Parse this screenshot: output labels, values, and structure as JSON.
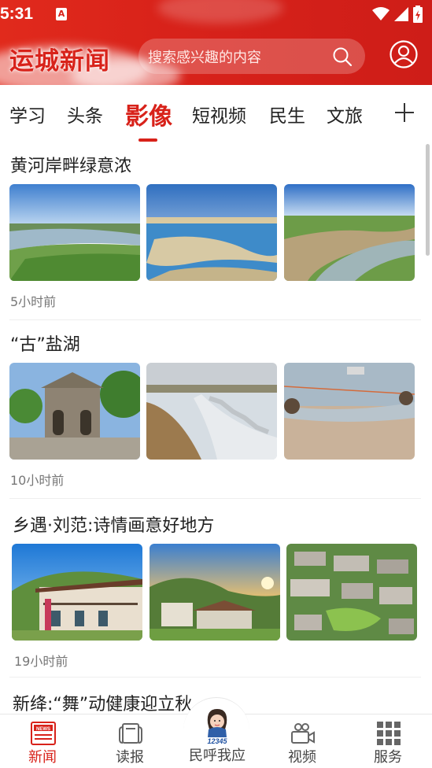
{
  "status": {
    "time": "5:31",
    "notification_badge": "A"
  },
  "header": {
    "logo": "运城新闻",
    "search_placeholder": "搜索感兴趣的内容",
    "brand_color": "#d8221a"
  },
  "tabs": [
    {
      "label": "学习",
      "active": false
    },
    {
      "label": "头条",
      "active": false
    },
    {
      "label": "影像",
      "active": true
    },
    {
      "label": "短视频",
      "active": false
    },
    {
      "label": "民生",
      "active": false
    },
    {
      "label": "文旅",
      "active": false
    }
  ],
  "articles": [
    {
      "title": "黄河岸畔绿意浓",
      "time": "5小时前",
      "images": [
        "river-aerial-green-banks",
        "river-blue-sky-reflection",
        "river-bend-farmland"
      ]
    },
    {
      "title": "“古”盐湖",
      "time": "10小时前",
      "images": [
        "ancient-stone-pavilion",
        "salt-lake-shore-stones",
        "fishermen-net-lake"
      ]
    },
    {
      "title": "乡遇·刘范:诗情画意好地方",
      "time": "19小时前",
      "images": [
        "village-house-mountain",
        "village-sunset-hills",
        "village-aerial-rooftops"
      ]
    },
    {
      "title": "新绛:“舞”动健康迎立秋",
      "time": "",
      "images": []
    }
  ],
  "bottom_nav": [
    {
      "label": "新闻",
      "icon": "news-icon",
      "active": true
    },
    {
      "label": "读报",
      "icon": "newspaper-icon",
      "active": false
    },
    {
      "label": "民呼我应",
      "icon": "hotline-12345-icon",
      "badge": "12345",
      "active": false
    },
    {
      "label": "视频",
      "icon": "video-camera-icon",
      "active": false
    },
    {
      "label": "服务",
      "icon": "grid-icon",
      "active": false
    }
  ]
}
